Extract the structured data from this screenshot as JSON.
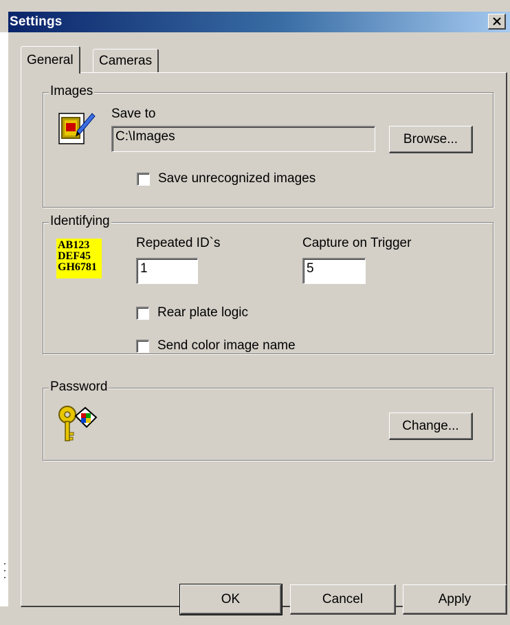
{
  "window": {
    "title": "Settings"
  },
  "tabs": [
    {
      "label": "General",
      "active": true
    },
    {
      "label": "Cameras",
      "active": false
    }
  ],
  "images_group": {
    "label": "Images",
    "save_to_label": "Save to",
    "save_to_value": "C:\\Images",
    "browse_label": "Browse...",
    "save_unrecognized_label": "Save unrecognized images",
    "save_unrecognized_checked": false,
    "icon": "picture-edit-icon"
  },
  "identifying_group": {
    "label": "Identifying",
    "plate_lines": [
      "AB123",
      "DEF45",
      "GH6781"
    ],
    "repeated_ids_label": "Repeated ID`s",
    "repeated_ids_value": "1",
    "capture_on_trigger_label": "Capture on Trigger",
    "capture_on_trigger_value": "5",
    "rear_plate_logic_label": "Rear plate logic",
    "rear_plate_logic_checked": false,
    "send_color_image_label": "Send color image name",
    "send_color_image_checked": false
  },
  "password_group": {
    "label": "Password",
    "change_label": "Change...",
    "icon": "keys-icon"
  },
  "footer": {
    "ok_label": "OK",
    "cancel_label": "Cancel",
    "apply_label": "Apply"
  },
  "colors": {
    "title_start": "#0a246a",
    "title_end": "#a6caf0",
    "face": "#d4d0c8",
    "plate_bg": "#ffff00"
  }
}
